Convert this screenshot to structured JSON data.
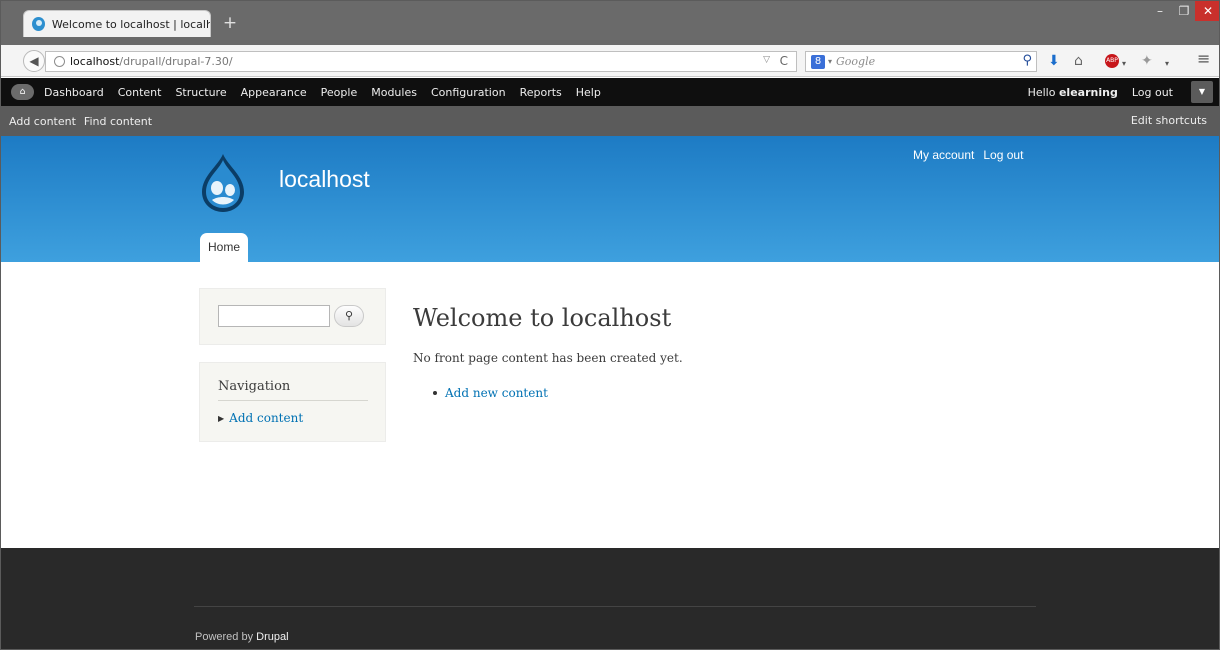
{
  "browser": {
    "tab_title": "Welcome to localhost | localh...",
    "new_tab_label": "+",
    "url_host": "localhost",
    "url_path": "/drupall/drupal-7.30/",
    "search_placeholder": "Google",
    "search_engine_badge": "8"
  },
  "admin_toolbar": {
    "items": [
      "Dashboard",
      "Content",
      "Structure",
      "Appearance",
      "People",
      "Modules",
      "Configuration",
      "Reports",
      "Help"
    ],
    "hello_prefix": "Hello",
    "username": "elearning",
    "logout_label": "Log out"
  },
  "shortcuts": {
    "items": [
      "Add content",
      "Find content"
    ],
    "edit_label": "Edit shortcuts"
  },
  "header": {
    "site_name": "localhost",
    "secondary_menu": [
      "My account",
      "Log out"
    ],
    "main_tab": "Home"
  },
  "sidebar": {
    "navigation_title": "Navigation",
    "navigation_items": [
      "Add content"
    ]
  },
  "main": {
    "title": "Welcome to localhost",
    "message": "No front page content has been created yet.",
    "links": [
      "Add new content"
    ]
  },
  "footer": {
    "powered_by": "Powered by",
    "powered_link": "Drupal"
  },
  "colors": {
    "header_blue": "#1d7bc4",
    "link_blue": "#0071b3",
    "toolbar_black": "#0f0f0f",
    "footer_dark": "#292929"
  }
}
